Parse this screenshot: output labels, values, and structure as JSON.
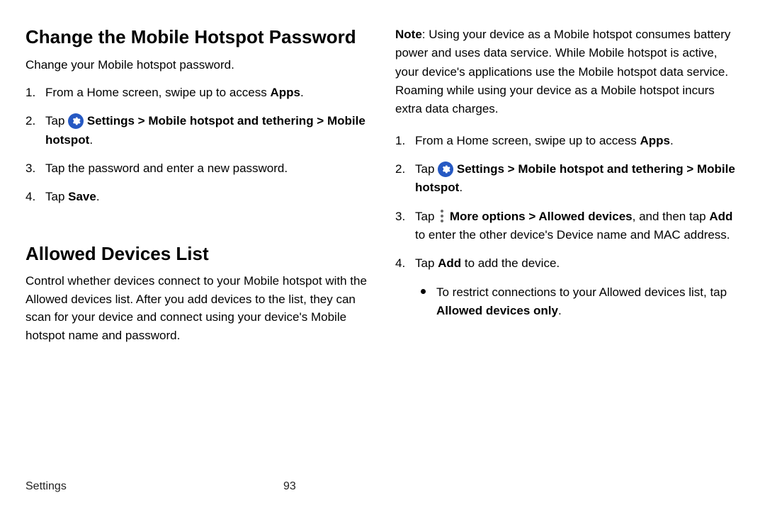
{
  "left": {
    "heading1": "Change the Mobile Hotspot Password",
    "intro1": "Change your Mobile hotspot password.",
    "steps1": {
      "s1_pre": "From a Home screen, swipe up to access ",
      "s1_bold": "Apps",
      "s1_post": ".",
      "s2_pre": "Tap ",
      "s2_b1": "Settings",
      "s2_mid1": " > ",
      "s2_b2": "Mobile hotspot and tethering",
      "s2_mid2": " > ",
      "s2_b3": "Mobile hotspot",
      "s2_post": ".",
      "s3": "Tap the password and enter a new password.",
      "s4_pre": "Tap ",
      "s4_bold": "Save",
      "s4_post": "."
    },
    "heading2": "Allowed Devices List",
    "intro2": "Control whether devices connect to your Mobile hotspot with the Allowed devices list. After you add devices to the list, they can scan for your device and connect using your device's Mobile hotspot name and password."
  },
  "right": {
    "note_label": "Note",
    "note_body": ": Using your device as a Mobile hotspot consumes battery power and uses data service. While Mobile hotspot is active, your device's applications use the Mobile hotspot data service. Roaming while using your device as a Mobile hotspot incurs extra data charges.",
    "steps": {
      "s1_pre": "From a Home screen, swipe up to access ",
      "s1_bold": "Apps",
      "s1_post": ".",
      "s2_pre": "Tap ",
      "s2_b1": "Settings",
      "s2_mid1": " > ",
      "s2_b2": "Mobile hotspot and tethering",
      "s2_mid2": " > ",
      "s2_b3": "Mobile hotspot",
      "s2_post": ".",
      "s3_pre": "Tap ",
      "s3_b1": "More options",
      "s3_mid1": " > ",
      "s3_b2": "Allowed devices",
      "s3_mid2": ", and then tap ",
      "s3_b3": "Add",
      "s3_post": " to enter the other device's Device name and MAC address.",
      "s4_pre": "Tap ",
      "s4_bold": "Add",
      "s4_post": " to add the device.",
      "sub_pre": "To restrict connections to your Allowed devices list, tap ",
      "sub_bold": "Allowed devices only",
      "sub_post": "."
    }
  },
  "footer": {
    "section": "Settings",
    "page": "93"
  }
}
